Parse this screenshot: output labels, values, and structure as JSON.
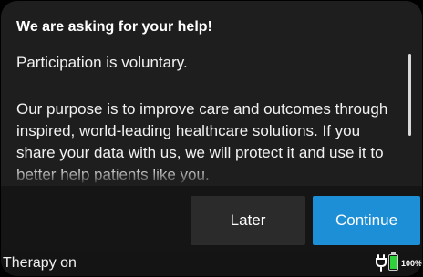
{
  "dialog": {
    "title": "We are asking for your help!",
    "paragraph1": "Participation is voluntary.",
    "paragraph2": "Our purpose is to improve care and outcomes through inspired, world-leading healthcare solutions. If you share your data with us, we will protect it and use it to better help patients like you."
  },
  "buttons": {
    "later_label": "Later",
    "continue_label": "Continue"
  },
  "status": {
    "therapy_text": "Therapy on",
    "plug_icon": "power-plug-icon",
    "battery_icon": "battery-icon",
    "battery_percent": "100%",
    "battery_level": 1.0
  },
  "colors": {
    "accent": "#1d8fd6",
    "battery": "#2fd13a"
  }
}
